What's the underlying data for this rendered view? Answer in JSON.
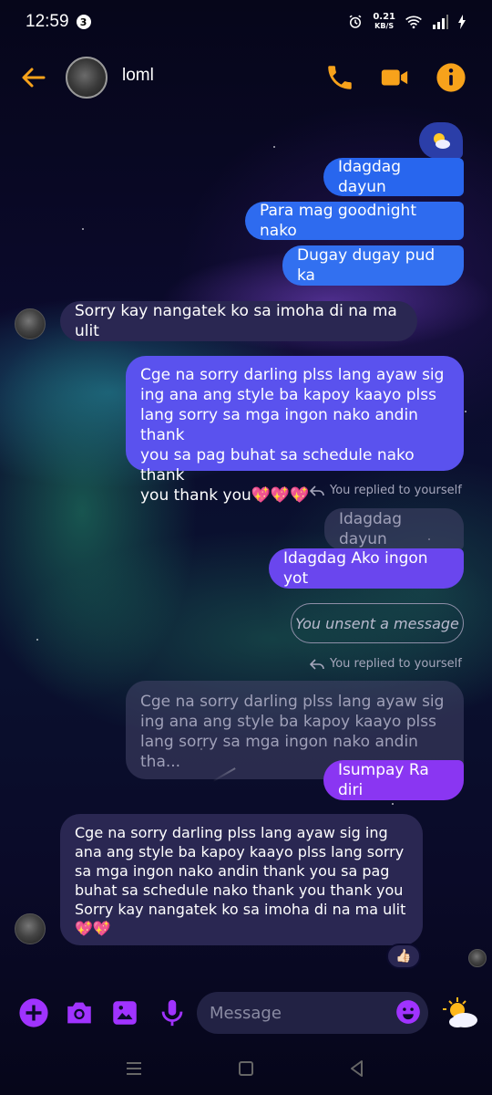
{
  "status_bar": {
    "time": "12:59",
    "notification_count": "3",
    "net_speed_value": "0.21",
    "net_speed_unit": "KB/S"
  },
  "header": {
    "contact_name": "loml"
  },
  "messages": {
    "m1": "Idagdag dayun",
    "m2": "Para mag goodnight nako",
    "m3": "Dugay dugay pud ka",
    "m4": "Sorry kay nangatek ko sa imoha di na ma ulit",
    "m5_lines": [
      "Cge na sorry darling plss lang ayaw sig",
      "ing ana ang style ba kapoy kaayo plss",
      "lang sorry sa mga ingon nako andin thank",
      "you sa pag buhat sa schedule nako thank",
      "you thank you💖💖💖"
    ],
    "reply_note_1": "You replied to yourself",
    "quoted_1": "Idagdag dayun",
    "m6": "Idagdag Ako ingon yot",
    "unsent": "You unsent a message",
    "reply_note_2": "You replied to yourself",
    "quoted_2_lines": [
      "Cge na sorry darling plss lang ayaw sig",
      "ing ana ang style ba kapoy kaayo plss",
      "lang sorry sa mga ingon nako andin tha..."
    ],
    "m7": "Isumpay Ra diri",
    "m8_lines": [
      "Cge na sorry darling plss lang ayaw sig ing",
      "ana ang style ba kapoy kaayo plss lang sorry",
      "sa mga ingon nako andin thank you sa pag",
      "buhat sa schedule nako thank you thank you",
      "Sorry kay nangatek ko sa imoha di na ma ulit",
      "💖💖"
    ],
    "reaction": "👍🏻"
  },
  "composer": {
    "placeholder": "Message"
  },
  "colors": {
    "accent_orange": "#F7A21B",
    "accent_purple": "#A033FF",
    "bubble_blue": "#2D6BF0",
    "bubble_purple": "#7B3CF0"
  }
}
